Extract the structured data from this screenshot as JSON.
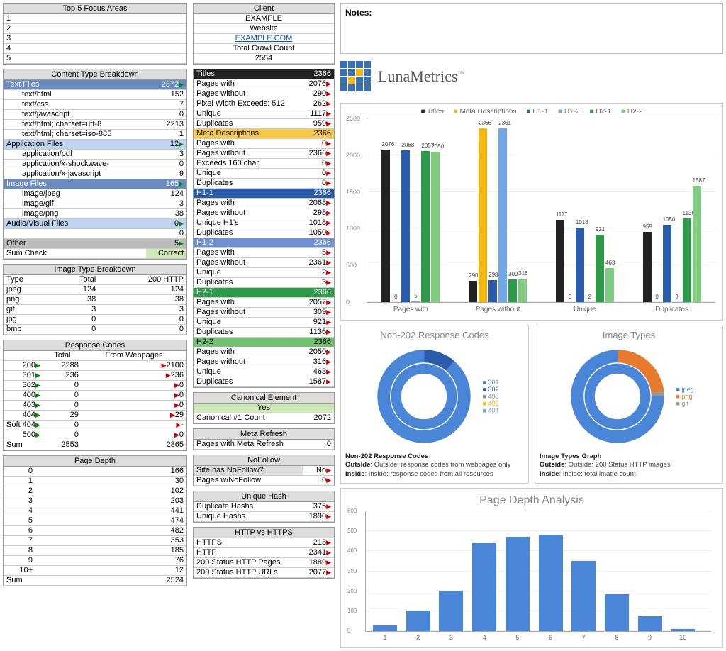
{
  "focus": {
    "title": "Top 5 Focus Areas",
    "rows": [
      "1",
      "2",
      "3",
      "4",
      "5"
    ]
  },
  "client": {
    "title": "Client",
    "name": "EXAMPLE",
    "website_label": "Website",
    "website_url": "EXAMPLE.COM",
    "crawl_label": "Total Crawl Count",
    "crawl_count": "2554"
  },
  "content_breakdown": {
    "title": "Content Type Breakdown",
    "groups": [
      {
        "label": "Text Files",
        "value": "2372",
        "class": "sec-blue",
        "items": [
          {
            "label": "text/html",
            "value": "152"
          },
          {
            "label": "text/css",
            "value": "7"
          },
          {
            "label": "text/javascript",
            "value": "0"
          },
          {
            "label": "text/html; charset=utf-8",
            "value": "2213"
          },
          {
            "label": "text/html; charset=iso-885",
            "value": "1"
          }
        ]
      },
      {
        "label": "Application Files",
        "value": "12",
        "class": "sec-lightblue",
        "items": [
          {
            "label": "application/pdf",
            "value": "3"
          },
          {
            "label": "application/x-shockwave-",
            "value": "0"
          },
          {
            "label": "application/x-javascript",
            "value": "9"
          }
        ]
      },
      {
        "label": "Image Files",
        "value": "165",
        "class": "sec-blue",
        "items": [
          {
            "label": "image/jpeg",
            "value": "124"
          },
          {
            "label": "image/gif",
            "value": "3"
          },
          {
            "label": "image/png",
            "value": "38"
          }
        ]
      },
      {
        "label": "Audio/Visual Files",
        "value": "0",
        "class": "sec-lightblue",
        "items": [
          {
            "label": "",
            "value": "0"
          }
        ]
      },
      {
        "label": "Other",
        "value": "5",
        "class": "sec-other",
        "items": []
      }
    ],
    "sum_label": "Sum Check",
    "sum_value": "Correct"
  },
  "image_breakdown": {
    "title": "Image Type Breakdown",
    "headers": [
      "Type",
      "Total",
      "200 HTTP"
    ],
    "rows": [
      [
        "jpeg",
        "124",
        "124"
      ],
      [
        "png",
        "38",
        "38"
      ],
      [
        "gif",
        "3",
        "3"
      ],
      [
        "jpg",
        "0",
        "0"
      ],
      [
        "bmp",
        "0",
        "0"
      ]
    ]
  },
  "response_codes": {
    "title": "Response Codes",
    "headers": [
      "",
      "Total",
      "From Webpages"
    ],
    "rows": [
      [
        "200",
        "2288",
        "2100"
      ],
      [
        "301",
        "236",
        "236"
      ],
      [
        "302",
        "0",
        "0"
      ],
      [
        "400",
        "0",
        "0"
      ],
      [
        "403",
        "0",
        "0"
      ],
      [
        "404",
        "29",
        "29"
      ],
      [
        "Soft 404",
        "0",
        "-"
      ],
      [
        "500",
        "0",
        "0"
      ]
    ],
    "sum": [
      "Sum",
      "2553",
      "2365"
    ]
  },
  "page_depth": {
    "title": "Page Depth",
    "rows": [
      [
        "0",
        "166"
      ],
      [
        "1",
        "30"
      ],
      [
        "2",
        "102"
      ],
      [
        "3",
        "203"
      ],
      [
        "4",
        "441"
      ],
      [
        "5",
        "474"
      ],
      [
        "6",
        "482"
      ],
      [
        "7",
        "353"
      ],
      [
        "8",
        "185"
      ],
      [
        "9",
        "76"
      ],
      [
        "10+",
        "12"
      ]
    ],
    "sum": [
      "Sum",
      "2524"
    ]
  },
  "head_sections": [
    {
      "name": "Titles",
      "class": "sec-black",
      "total": "2366",
      "rows": [
        [
          "Pages with",
          "2076"
        ],
        [
          "Pages without",
          "290"
        ],
        [
          "Pixel Width Exceeds:          512",
          "262"
        ],
        [
          "Unique",
          "1117"
        ],
        [
          "Duplicates",
          "959"
        ]
      ]
    },
    {
      "name": "Meta Descriptions",
      "class": "sec-yellow",
      "total": "2366",
      "rows": [
        [
          "Pages with",
          "0"
        ],
        [
          "Pages without",
          "2366"
        ],
        [
          "Exceeds 160 char.",
          "0"
        ],
        [
          "Unique",
          "0"
        ],
        [
          "Duplicates",
          "0"
        ]
      ]
    },
    {
      "name": "H1-1",
      "class": "sec-blue2",
      "total": "2366",
      "rows": [
        [
          "Pages with",
          "2068"
        ],
        [
          "Pages without",
          "298"
        ],
        [
          "Unique H1's",
          "1018"
        ],
        [
          "Duplicates",
          "1050"
        ]
      ]
    },
    {
      "name": "H1-2",
      "class": "sec-blue3",
      "total": "2366",
      "rows": [
        [
          "Pages with",
          "5"
        ],
        [
          "Pages without",
          "2361"
        ],
        [
          "Unique",
          "2"
        ],
        [
          "Duplicates",
          "3"
        ]
      ]
    },
    {
      "name": "H2-1",
      "class": "sec-green",
      "total": "2366",
      "rows": [
        [
          "Pages with",
          "2057"
        ],
        [
          "Pages without",
          "309"
        ],
        [
          "Unique",
          "921"
        ],
        [
          "Duplicates",
          "1136"
        ]
      ]
    },
    {
      "name": "H2-2",
      "class": "sec-green2",
      "total": "2366",
      "rows": [
        [
          "Pages with",
          "2050"
        ],
        [
          "Pages without",
          "316"
        ],
        [
          "Unique",
          "463"
        ],
        [
          "Duplicates",
          "1587"
        ]
      ]
    }
  ],
  "canonical": {
    "title": "Canonical Element",
    "answer": "Yes",
    "row": [
      "Canonical #1 Count",
      "2072"
    ]
  },
  "meta_refresh": {
    "title": "Meta Refresh",
    "row": [
      "Pages with Meta Refresh",
      "0"
    ]
  },
  "nofollow": {
    "title": "NoFollow",
    "rows": [
      [
        "Site has NoFollow?",
        "No"
      ],
      [
        "Pages w/NoFollow",
        "0"
      ]
    ]
  },
  "unique_hash": {
    "title": "Unique Hash",
    "rows": [
      [
        "Duplicate Hashs",
        "375"
      ],
      [
        "Unique Hashs",
        "1890"
      ]
    ]
  },
  "http_https": {
    "title": "HTTP vs HTTPS",
    "rows": [
      [
        "HTTPS",
        "213"
      ],
      [
        "HTTP",
        "2341"
      ],
      [
        "200 Status HTTP Pages",
        "1889"
      ],
      [
        "200 Status HTTP URLs",
        "2077"
      ]
    ]
  },
  "notes_label": "Notes:",
  "brand": "LunaMetrics",
  "chart_data": {
    "bar_chart": {
      "type": "bar",
      "title": "",
      "series_names": [
        "Titles",
        "Meta Descriptions",
        "H1-1",
        "H1-2",
        "H2-1",
        "H2-2"
      ],
      "categories": [
        "Pages with",
        "Pages without",
        "Unique",
        "Duplicates"
      ],
      "series": [
        {
          "name": "Titles",
          "values": [
            2076,
            290,
            1117,
            959
          ]
        },
        {
          "name": "Meta Descriptions",
          "values": [
            0,
            2366,
            0,
            0
          ]
        },
        {
          "name": "H1-1",
          "values": [
            2068,
            298,
            1018,
            1050
          ]
        },
        {
          "name": "H1-2",
          "values": [
            5,
            2361,
            2,
            3
          ]
        },
        {
          "name": "H2-1",
          "values": [
            2057,
            309,
            921,
            1136
          ]
        },
        {
          "name": "H2-2",
          "values": [
            2050,
            316,
            463,
            1587
          ]
        }
      ],
      "ylim": [
        0,
        2500
      ]
    },
    "donut_response": {
      "type": "pie",
      "title": "Non-202 Response Codes",
      "legend": [
        "301",
        "302",
        "400",
        "403",
        "404"
      ],
      "outside": [
        236,
        0,
        0,
        0,
        29
      ],
      "inside": [
        236,
        0,
        0,
        0,
        29
      ],
      "desc_title": "Non-202 Response Codes",
      "desc1": "Outside: response codes from webpages only",
      "desc2": "Inside: response codes from all resources"
    },
    "donut_images": {
      "type": "pie",
      "title": "Image Types",
      "legend": [
        "jpeg",
        "png",
        "gif"
      ],
      "outside": [
        124,
        38,
        3
      ],
      "inside": [
        124,
        38,
        3
      ],
      "desc_title": "Image Types Graph",
      "desc1": "Outside: 200 Status HTTP images",
      "desc2": "Inside: total image count"
    },
    "depth_chart": {
      "type": "bar",
      "title": "Page Depth Analysis",
      "categories": [
        "1",
        "2",
        "3",
        "4",
        "5",
        "6",
        "7",
        "8",
        "9",
        "10"
      ],
      "values": [
        30,
        102,
        203,
        441,
        474,
        482,
        353,
        185,
        76,
        12
      ],
      "ylim": [
        0,
        600
      ]
    }
  }
}
